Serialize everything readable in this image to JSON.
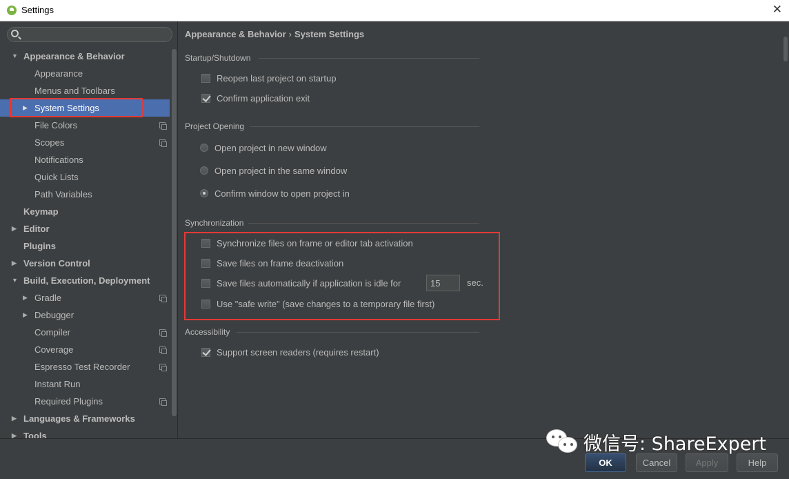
{
  "window": {
    "title": "Settings",
    "close_symbol": "✕"
  },
  "search": {
    "placeholder": ""
  },
  "tree": [
    {
      "label": "Appearance & Behavior",
      "level": 0,
      "bold": true,
      "arrow": "▼"
    },
    {
      "label": "Appearance",
      "level": 1
    },
    {
      "label": "Menus and Toolbars",
      "level": 1
    },
    {
      "label": "System Settings",
      "level": 1,
      "arrow": "▶",
      "selected": true
    },
    {
      "label": "File Colors",
      "level": 1,
      "project": true
    },
    {
      "label": "Scopes",
      "level": 1,
      "project": true
    },
    {
      "label": "Notifications",
      "level": 1
    },
    {
      "label": "Quick Lists",
      "level": 1
    },
    {
      "label": "Path Variables",
      "level": 1
    },
    {
      "label": "Keymap",
      "level": 0,
      "bold": true
    },
    {
      "label": "Editor",
      "level": 0,
      "bold": true,
      "arrow": "▶"
    },
    {
      "label": "Plugins",
      "level": 0,
      "bold": true
    },
    {
      "label": "Version Control",
      "level": 0,
      "bold": true,
      "arrow": "▶"
    },
    {
      "label": "Build, Execution, Deployment",
      "level": 0,
      "bold": true,
      "arrow": "▼"
    },
    {
      "label": "Gradle",
      "level": 1,
      "arrow": "▶",
      "project": true
    },
    {
      "label": "Debugger",
      "level": 1,
      "arrow": "▶"
    },
    {
      "label": "Compiler",
      "level": 1,
      "project": true
    },
    {
      "label": "Coverage",
      "level": 1,
      "project": true
    },
    {
      "label": "Espresso Test Recorder",
      "level": 1,
      "project": true
    },
    {
      "label": "Instant Run",
      "level": 1
    },
    {
      "label": "Required Plugins",
      "level": 1,
      "project": true
    },
    {
      "label": "Languages & Frameworks",
      "level": 0,
      "bold": true,
      "arrow": "▶"
    },
    {
      "label": "Tools",
      "level": 0,
      "bold": true,
      "arrow": "▶"
    }
  ],
  "breadcrumb": {
    "parent": "Appearance & Behavior",
    "separator": "›",
    "current": "System Settings"
  },
  "startup": {
    "title": "Startup/Shutdown",
    "reopen": {
      "label": "Reopen last project on startup",
      "checked": false
    },
    "confirm_exit": {
      "label": "Confirm application exit",
      "checked": true
    }
  },
  "project_opening": {
    "title": "Project Opening",
    "options": [
      {
        "label": "Open project in new window",
        "checked": false
      },
      {
        "label": "Open project in the same window",
        "checked": false
      },
      {
        "label": "Confirm window to open project in",
        "checked": true
      }
    ]
  },
  "sync": {
    "title": "Synchronization",
    "frame_activation": {
      "label": "Synchronize files on frame or editor tab activation",
      "checked": false
    },
    "frame_deactivation": {
      "label": "Save files on frame deactivation",
      "checked": false
    },
    "idle_save": {
      "label": "Save files automatically if application is idle for",
      "checked": false,
      "value": "15",
      "unit": "sec."
    },
    "safe_write": {
      "label": "Use \"safe write\" (save changes to a temporary file first)",
      "checked": false
    }
  },
  "accessibility": {
    "title": "Accessibility",
    "screen_readers": {
      "label": "Support screen readers (requires restart)",
      "checked": true
    }
  },
  "buttons": {
    "ok": "OK",
    "cancel": "Cancel",
    "apply": "Apply",
    "help": "Help"
  },
  "watermark": {
    "text": "微信号: ShareExpert"
  },
  "colors": {
    "selection": "#4b6eaf",
    "highlight_box": "#e53935",
    "background": "#3c3f41"
  }
}
